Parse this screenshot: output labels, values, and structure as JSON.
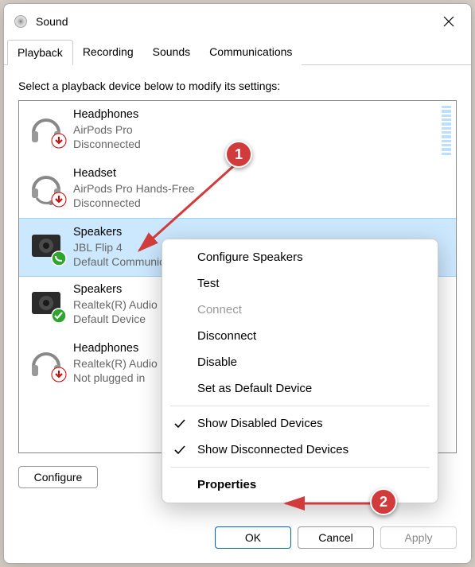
{
  "window": {
    "title": "Sound"
  },
  "tabs": [
    {
      "label": "Playback",
      "active": true
    },
    {
      "label": "Recording"
    },
    {
      "label": "Sounds"
    },
    {
      "label": "Communications"
    }
  ],
  "instruction": "Select a playback device below to modify its settings:",
  "devices": [
    {
      "name": "Headphones",
      "desc": "AirPods Pro",
      "status": "Disconnected",
      "kind": "headphones",
      "badge": "down",
      "selected": false
    },
    {
      "name": "Headset",
      "desc": "AirPods Pro Hands-Free",
      "status": "Disconnected",
      "kind": "headset",
      "badge": "down",
      "selected": false
    },
    {
      "name": "Speakers",
      "desc": "JBL Flip 4",
      "status": "Default Communications Device",
      "kind": "speaker",
      "badge": "phone",
      "selected": true,
      "meter": true
    },
    {
      "name": "Speakers",
      "desc": "Realtek(R) Audio",
      "status": "Default Device",
      "kind": "speaker",
      "badge": "check",
      "selected": false,
      "meter": true
    },
    {
      "name": "Headphones",
      "desc": "Realtek(R) Audio",
      "status": "Not plugged in",
      "kind": "headphones",
      "badge": "down",
      "selected": false
    }
  ],
  "context_menu": {
    "items": [
      {
        "label": "Configure Speakers",
        "type": "item"
      },
      {
        "label": "Test",
        "type": "item"
      },
      {
        "label": "Connect",
        "type": "item",
        "disabled": true
      },
      {
        "label": "Disconnect",
        "type": "item"
      },
      {
        "label": "Disable",
        "type": "item"
      },
      {
        "label": "Set as Default Device",
        "type": "item"
      },
      {
        "type": "sep"
      },
      {
        "label": "Show Disabled Devices",
        "type": "item",
        "checked": true
      },
      {
        "label": "Show Disconnected Devices",
        "type": "item",
        "checked": true
      },
      {
        "type": "sep"
      },
      {
        "label": "Properties",
        "type": "item",
        "bold": true
      }
    ]
  },
  "buttons": {
    "configure": "Configure",
    "ok": "OK",
    "cancel": "Cancel",
    "apply": "Apply"
  },
  "annotations": {
    "step1": "1",
    "step2": "2"
  }
}
